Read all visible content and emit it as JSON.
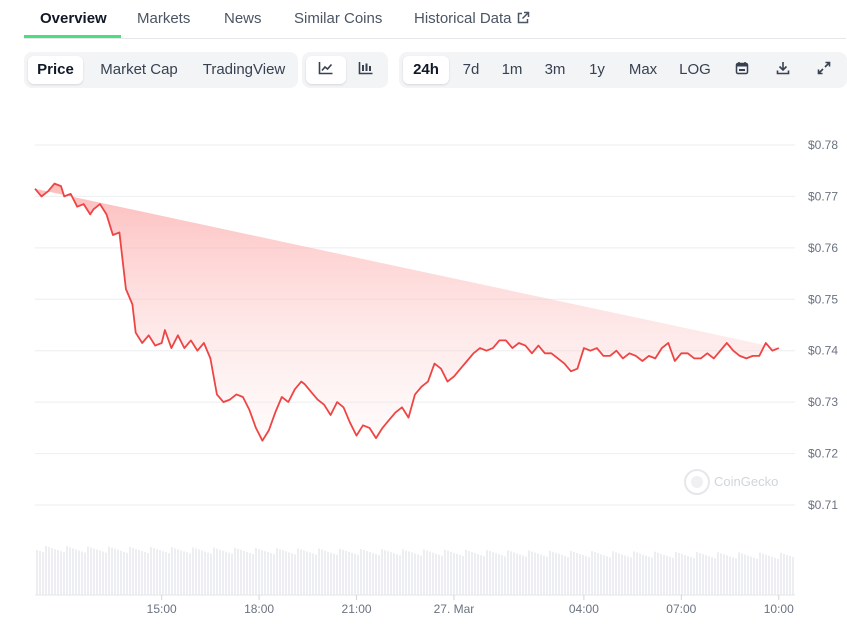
{
  "tabs": [
    {
      "label": "Overview"
    },
    {
      "label": "Markets"
    },
    {
      "label": "News"
    },
    {
      "label": "Similar Coins"
    },
    {
      "label": "Historical Data"
    }
  ],
  "view_buttons": [
    {
      "label": "Price",
      "selected": true
    },
    {
      "label": "Market Cap",
      "selected": false
    },
    {
      "label": "TradingView",
      "selected": false
    }
  ],
  "chart_style_icons": [
    {
      "icon": "line-chart-icon",
      "selected": true
    },
    {
      "icon": "candlestick-chart-icon",
      "selected": false
    }
  ],
  "range_buttons": [
    {
      "label": "24h",
      "selected": true
    },
    {
      "label": "7d",
      "selected": false
    },
    {
      "label": "1m",
      "selected": false
    },
    {
      "label": "3m",
      "selected": false
    },
    {
      "label": "1y",
      "selected": false
    },
    {
      "label": "Max",
      "selected": false
    },
    {
      "label": "LOG",
      "selected": false
    }
  ],
  "tool_icons": [
    "calendar-icon",
    "download-icon",
    "fullscreen-icon"
  ],
  "watermark": "CoinGecko",
  "colors": {
    "line": "#ef4444",
    "fill": "#fecaca",
    "accent": "#4ade80"
  },
  "chart_data": {
    "type": "area",
    "ylim": [
      0.71,
      0.78
    ],
    "y_ticks": [
      "$0.78",
      "$0.77",
      "$0.76",
      "$0.75",
      "$0.74",
      "$0.73",
      "$0.72",
      "$0.71"
    ],
    "y_tick_values": [
      0.78,
      0.77,
      0.76,
      0.75,
      0.74,
      0.73,
      0.72,
      0.71
    ],
    "x_ticks": [
      "15:00",
      "18:00",
      "21:00",
      "27. Mar",
      "04:00",
      "07:00",
      "10:00"
    ],
    "x_tick_hours": [
      15,
      18,
      21,
      24,
      28,
      31,
      34
    ],
    "x_range_hours": [
      11.1,
      34.5
    ],
    "series": [
      {
        "hours": [
          11.1,
          11.3,
          11.5,
          11.7,
          11.9,
          12.0,
          12.2,
          12.4,
          12.6,
          12.8,
          12.9,
          13.1,
          13.3,
          13.4,
          13.5,
          13.7,
          13.9,
          14.1,
          14.2,
          14.4,
          14.6,
          14.8,
          15.0,
          15.1,
          15.3,
          15.5,
          15.7,
          15.9,
          16.1,
          16.3,
          16.5,
          16.7,
          16.9,
          17.1,
          17.3,
          17.5,
          17.7,
          17.9,
          18.1,
          18.3,
          18.5,
          18.7,
          18.9,
          19.1,
          19.3,
          19.4,
          19.6,
          19.8,
          20.0,
          20.2,
          20.4,
          20.6,
          20.8,
          21.0,
          21.2,
          21.4,
          21.6,
          21.8,
          22.0,
          22.2,
          22.4,
          22.6,
          22.8,
          23.0,
          23.2,
          23.4,
          23.6,
          23.8,
          24.0,
          24.2,
          24.4,
          24.6,
          24.8,
          25.0,
          25.2,
          25.4,
          25.6,
          25.8,
          26.0,
          26.2,
          26.4,
          26.6,
          26.8,
          27.0,
          27.2,
          27.4,
          27.6,
          27.8,
          28.0,
          28.2,
          28.4,
          28.6,
          28.8,
          29.0,
          29.2,
          29.4,
          29.6,
          29.8,
          30.0,
          30.2,
          30.4,
          30.6,
          30.8,
          31.0,
          31.2,
          31.4,
          31.6,
          31.8,
          32.0,
          32.2,
          32.4,
          32.6,
          32.8,
          33.0,
          33.2,
          33.4,
          33.6,
          33.8,
          34.0,
          34.2,
          34.4
        ],
        "price": [
          0.7715,
          0.77,
          0.771,
          0.7725,
          0.772,
          0.77,
          0.7705,
          0.768,
          0.7685,
          0.7665,
          0.7675,
          0.7685,
          0.7665,
          0.7645,
          0.7625,
          0.763,
          0.752,
          0.749,
          0.7435,
          0.7415,
          0.743,
          0.741,
          0.7415,
          0.744,
          0.7405,
          0.743,
          0.7405,
          0.742,
          0.74,
          0.7415,
          0.7385,
          0.7315,
          0.73,
          0.7305,
          0.7315,
          0.731,
          0.7285,
          0.725,
          0.7225,
          0.7245,
          0.728,
          0.731,
          0.73,
          0.7325,
          0.734,
          0.7335,
          0.732,
          0.7305,
          0.7295,
          0.7275,
          0.73,
          0.729,
          0.726,
          0.7235,
          0.7255,
          0.725,
          0.723,
          0.725,
          0.7265,
          0.728,
          0.729,
          0.727,
          0.7315,
          0.733,
          0.734,
          0.7375,
          0.7365,
          0.734,
          0.735,
          0.7365,
          0.738,
          0.7395,
          0.7405,
          0.74,
          0.7405,
          0.742,
          0.742,
          0.7405,
          0.7415,
          0.741,
          0.7395,
          0.741,
          0.7395,
          0.7395,
          0.7385,
          0.7375,
          0.736,
          0.7365,
          0.7405,
          0.74,
          0.7405,
          0.739,
          0.739,
          0.74,
          0.7385,
          0.7395,
          0.739,
          0.738,
          0.739,
          0.7385,
          0.7405,
          0.7415,
          0.738,
          0.7395,
          0.7395,
          0.7385,
          0.7385,
          0.7395,
          0.7385,
          0.74,
          0.7415,
          0.74,
          0.739,
          0.7385,
          0.739,
          0.739,
          0.7415,
          0.74,
          0.7405
        ]
      }
    ]
  }
}
